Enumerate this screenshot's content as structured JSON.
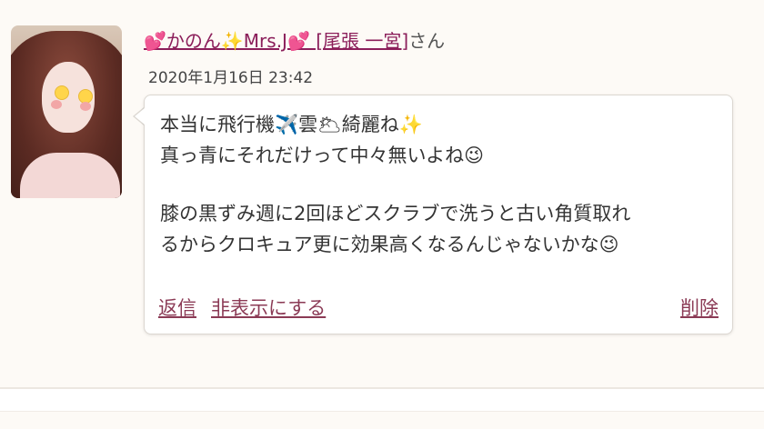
{
  "comment": {
    "user_name": "💕かのん✨Mrs.J💕 [尾張 一宮]",
    "honorific": "さん",
    "timestamp": "2020年1月16日 23:42",
    "message_lines": [
      "本当に飛行機✈️雲🌥綺麗ね✨",
      "真っ青にそれだけって中々無いよね😉",
      "",
      "膝の黒ずみ週に2回ほどスクラブで洗うと古い角質取れ",
      "るからクロキュア更に効果高くなるんじゃないかな😉"
    ],
    "actions": {
      "reply_label": "返信",
      "hide_label": "非表示にする",
      "delete_label": "削除"
    }
  },
  "colors": {
    "link": "#8b1e5a",
    "action_link": "#8b3a55",
    "card_background": "#fdfaf6",
    "bubble_background": "#ffffff",
    "text": "#333333"
  }
}
